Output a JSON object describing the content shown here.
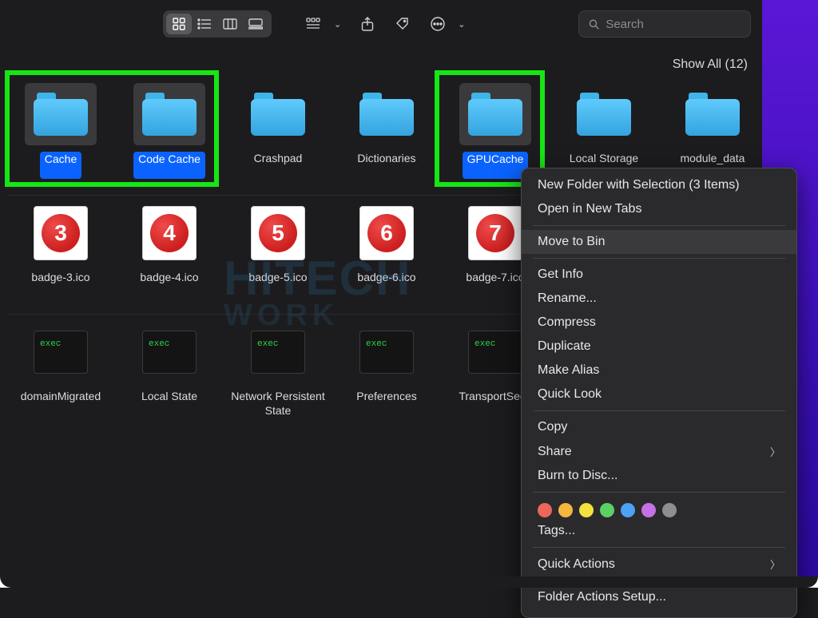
{
  "toolbar": {
    "search_placeholder": "Search"
  },
  "showall": {
    "text": "Show All  (12)"
  },
  "rows": [
    {
      "items": [
        {
          "kind": "folder",
          "label": "Cache",
          "selected": true
        },
        {
          "kind": "folder",
          "label": "Code Cache",
          "selected": true
        },
        {
          "kind": "folder",
          "label": "Crashpad",
          "selected": false
        },
        {
          "kind": "folder",
          "label": "Dictionaries",
          "selected": false
        },
        {
          "kind": "folder",
          "label": "GPUCache",
          "selected": true
        },
        {
          "kind": "folder",
          "label": "Local Storage",
          "selected": false
        },
        {
          "kind": "folder",
          "label": "module_data",
          "selected": false
        }
      ]
    },
    {
      "items": [
        {
          "kind": "badge",
          "num": "3",
          "label": "badge-3.ico"
        },
        {
          "kind": "badge",
          "num": "4",
          "label": "badge-4.ico"
        },
        {
          "kind": "badge",
          "num": "5",
          "label": "badge-5.ico"
        },
        {
          "kind": "badge",
          "num": "6",
          "label": "badge-6.ico"
        },
        {
          "kind": "badge",
          "num": "7",
          "label": "badge-7.ico"
        }
      ]
    },
    {
      "items": [
        {
          "kind": "exec",
          "label": "domainMigrated"
        },
        {
          "kind": "exec",
          "label": "Local State"
        },
        {
          "kind": "exec",
          "label": "Network Persistent State"
        },
        {
          "kind": "exec",
          "label": "Preferences"
        },
        {
          "kind": "exec",
          "label": "TransportSecu"
        }
      ]
    }
  ],
  "menu": {
    "items": [
      {
        "label": "New Folder with Selection (3 Items)"
      },
      {
        "label": "Open in New Tabs"
      },
      {
        "sep": true
      },
      {
        "label": "Move to Bin",
        "highlight": true
      },
      {
        "sep": true
      },
      {
        "label": "Get Info"
      },
      {
        "label": "Rename..."
      },
      {
        "label": "Compress"
      },
      {
        "label": "Duplicate"
      },
      {
        "label": "Make Alias"
      },
      {
        "label": "Quick Look"
      },
      {
        "sep": true
      },
      {
        "label": "Copy"
      },
      {
        "label": "Share",
        "submenu": true
      },
      {
        "label": "Burn to Disc..."
      },
      {
        "sep": true
      },
      {
        "tags": [
          "#ec675a",
          "#f4b63e",
          "#f4e03e",
          "#5cd062",
          "#4aa3f4",
          "#c471e8",
          "#8e8e90"
        ]
      },
      {
        "label": "Tags..."
      },
      {
        "sep": true
      },
      {
        "label": "Quick Actions",
        "submenu": true
      },
      {
        "sep": true
      },
      {
        "label": "Folder Actions Setup..."
      }
    ]
  },
  "watermark": {
    "line1": "HITECH",
    "line2": "WORK"
  }
}
